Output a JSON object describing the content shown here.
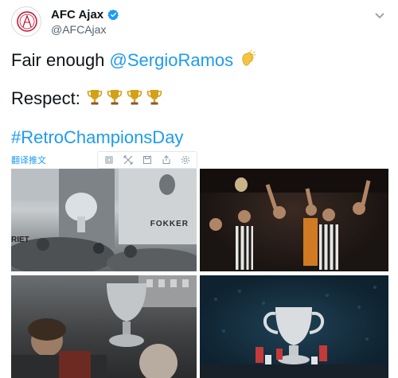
{
  "account": {
    "display_name": "AFC Ajax",
    "handle": "@AFCAjax"
  },
  "tweet": {
    "line1_text": "Fair enough ",
    "line1_mention": "@SergioRamos",
    "line2_text": "Respect: ",
    "hashtag": "#RetroChampionsDay",
    "trophy_count": 4
  },
  "translate_label": "翻译推文",
  "photos": {
    "photo1_signs": [
      "RIET",
      "FOKKER"
    ]
  },
  "colors": {
    "accent": "#1d9bf0",
    "text": "#0f1419",
    "secondary": "#536471",
    "trophy": "#d4a017"
  },
  "icons": [
    "ajax-logo-icon",
    "verified-badge-icon",
    "chevron-down-icon",
    "clapping-hands-icon",
    "trophy-icon",
    "copy-icon",
    "expand-icon",
    "save-icon",
    "share-icon",
    "settings-icon"
  ]
}
